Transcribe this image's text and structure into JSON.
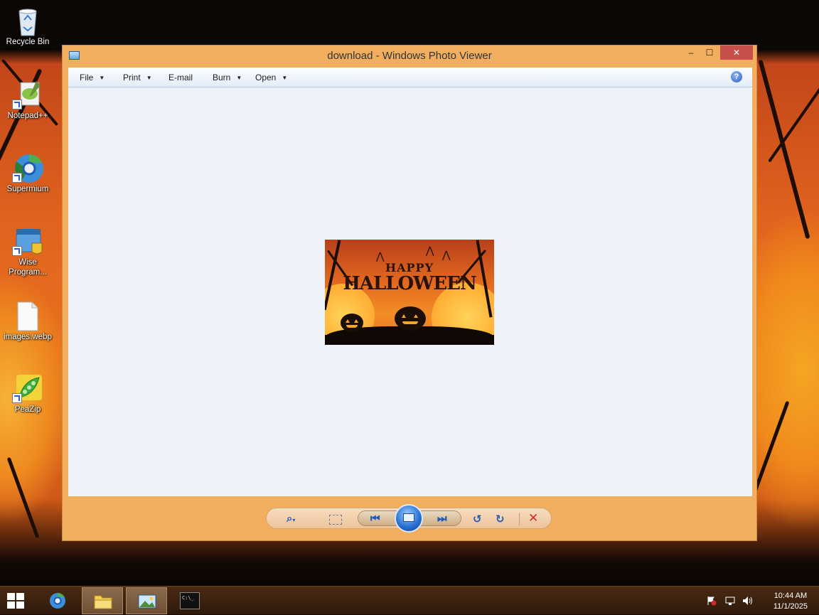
{
  "desktop": {
    "icons": [
      {
        "label": "Recycle Bin",
        "icon": "recycle-bin-icon"
      },
      {
        "label": "Notepad++",
        "icon": "notepad-plus-plus-icon"
      },
      {
        "label": "Supermium",
        "icon": "supermium-browser-icon"
      },
      {
        "label": "Wise Program...",
        "icon": "wise-program-uninstaller-icon"
      },
      {
        "label": "images.webp",
        "icon": "file-icon"
      },
      {
        "label": "PeaZip",
        "icon": "peazip-icon"
      }
    ]
  },
  "window": {
    "title": "download - Windows Photo Viewer",
    "controls": {
      "minimize": "–",
      "maximize": "☐",
      "close": "✕"
    },
    "menu": [
      {
        "label": "File",
        "has_dropdown": true
      },
      {
        "label": "Print",
        "has_dropdown": true
      },
      {
        "label": "E-mail",
        "has_dropdown": false
      },
      {
        "label": "Burn",
        "has_dropdown": true
      },
      {
        "label": "Open",
        "has_dropdown": true
      }
    ],
    "help_glyph": "?",
    "photo": {
      "line1": "HAPPY",
      "line2": "HALLOWEEN"
    },
    "toolbar": {
      "zoom": "⌕",
      "zoom_dropdown": "▾",
      "previous": "⏮",
      "next": "⏭",
      "rotate_left": "↺",
      "rotate_right": "↻",
      "delete": "✕"
    }
  },
  "taskbar": {
    "items": [
      "start",
      "supermium",
      "file-explorer",
      "photo-viewer",
      "command-prompt"
    ],
    "active": "photo-viewer",
    "cmd_glyph": "C:\\_",
    "tray": {
      "time": "10:44 AM",
      "date": "11/1/2025"
    }
  },
  "colors": {
    "window_frame": "#f2ae5f",
    "close_button": "#c7504a",
    "viewer_background": "#eef3f9",
    "taskbar": "#3a2210"
  }
}
